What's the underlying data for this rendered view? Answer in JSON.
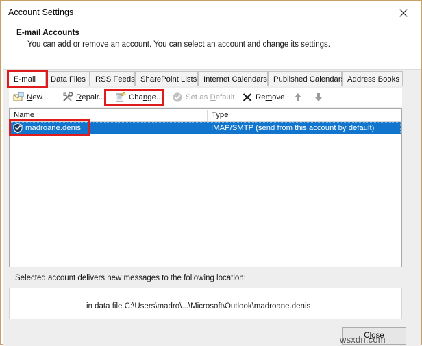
{
  "window": {
    "title": "Account Settings",
    "close_icon": "close-icon",
    "border_color": "#c9a063"
  },
  "header": {
    "title": "E-mail Accounts",
    "description": "You can add or remove an account. You can select an account and change its settings."
  },
  "tabs": [
    {
      "label": "E-mail",
      "active": true
    },
    {
      "label": "Data Files",
      "active": false
    },
    {
      "label": "RSS Feeds",
      "active": false
    },
    {
      "label": "SharePoint Lists",
      "active": false
    },
    {
      "label": "Internet Calendars",
      "active": false
    },
    {
      "label": "Published Calendars",
      "active": false
    },
    {
      "label": "Address Books",
      "active": false
    }
  ],
  "toolbar": {
    "new": {
      "label_pre": "",
      "label_key": "N",
      "label_post": "ew...",
      "icon": "new-mail-icon",
      "disabled": false
    },
    "repair": {
      "label_pre": "",
      "label_key": "R",
      "label_post": "epair...",
      "icon": "repair-tools-icon",
      "disabled": false
    },
    "change": {
      "label_pre": "Cha",
      "label_key": "n",
      "label_post": "ge...",
      "icon": "change-account-icon",
      "disabled": false
    },
    "set_as_default": {
      "label_pre": "Set as ",
      "label_key": "D",
      "label_post": "efault",
      "icon": "check-circle-icon",
      "disabled": true
    },
    "remove": {
      "label_pre": "Re",
      "label_key": "m",
      "label_post": "ove",
      "icon": "remove-x-icon",
      "disabled": false
    },
    "move_up": {
      "icon": "arrow-up-icon"
    },
    "move_down": {
      "icon": "arrow-down-icon"
    }
  },
  "account_list": {
    "columns": [
      "Name",
      "Type"
    ],
    "rows": [
      {
        "icon": "account-shield-check-icon",
        "name": "madroane.denis",
        "type": "IMAP/SMTP (send from this account by default)",
        "selected": true
      }
    ]
  },
  "delivery": {
    "label": "Selected account delivers new messages to the following location:",
    "path": "in data file C:\\Users\\madro\\...\\Microsoft\\Outlook\\madroane.denis"
  },
  "footer": {
    "close": {
      "label_pre": "C",
      "label_key": "l",
      "label_post": "ose"
    }
  },
  "annotations": {
    "highlight_color": "#e01b1b",
    "boxes": [
      "email-tab-highlight",
      "change-button-highlight",
      "account-row-highlight"
    ]
  },
  "watermark": {
    "text": "wsxdn.com"
  },
  "colors": {
    "selection_blue": "#1275cd",
    "panel_grey": "#efeeee",
    "border_gold": "#c9a063"
  }
}
